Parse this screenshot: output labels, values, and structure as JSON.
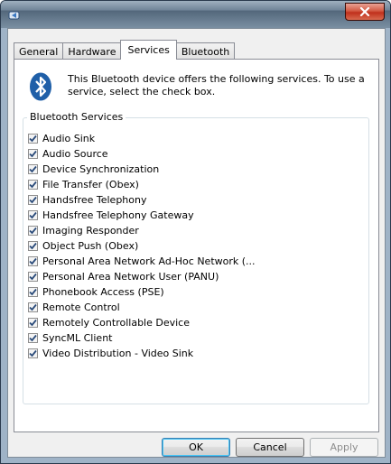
{
  "tabs": [
    {
      "label": "General"
    },
    {
      "label": "Hardware"
    },
    {
      "label": "Services"
    },
    {
      "label": "Bluetooth"
    }
  ],
  "intro_text": "This Bluetooth device offers the following services. To use a service, select the check box.",
  "group_title": "Bluetooth Services",
  "services": [
    {
      "label": "Audio Sink",
      "checked": true
    },
    {
      "label": "Audio Source",
      "checked": true
    },
    {
      "label": "Device Synchronization",
      "checked": true
    },
    {
      "label": "File Transfer (Obex)",
      "checked": true
    },
    {
      "label": "Handsfree Telephony",
      "checked": true
    },
    {
      "label": "Handsfree Telephony Gateway",
      "checked": true
    },
    {
      "label": "Imaging Responder",
      "checked": true
    },
    {
      "label": "Object Push (Obex)",
      "checked": true
    },
    {
      "label": "Personal Area Network Ad-Hoc Network (...",
      "checked": true
    },
    {
      "label": "Personal Area Network User (PANU)",
      "checked": true
    },
    {
      "label": "Phonebook Access (PSE)",
      "checked": true
    },
    {
      "label": "Remote Control",
      "checked": true
    },
    {
      "label": "Remotely Controllable Device",
      "checked": true
    },
    {
      "label": "SyncML Client",
      "checked": true
    },
    {
      "label": "Video Distribution - Video Sink",
      "checked": true
    }
  ],
  "buttons": {
    "ok": "OK",
    "cancel": "Cancel",
    "apply": "Apply"
  },
  "colors": {
    "bluetooth_blue": "#1f5fa8",
    "close_red": "#c0301c"
  }
}
